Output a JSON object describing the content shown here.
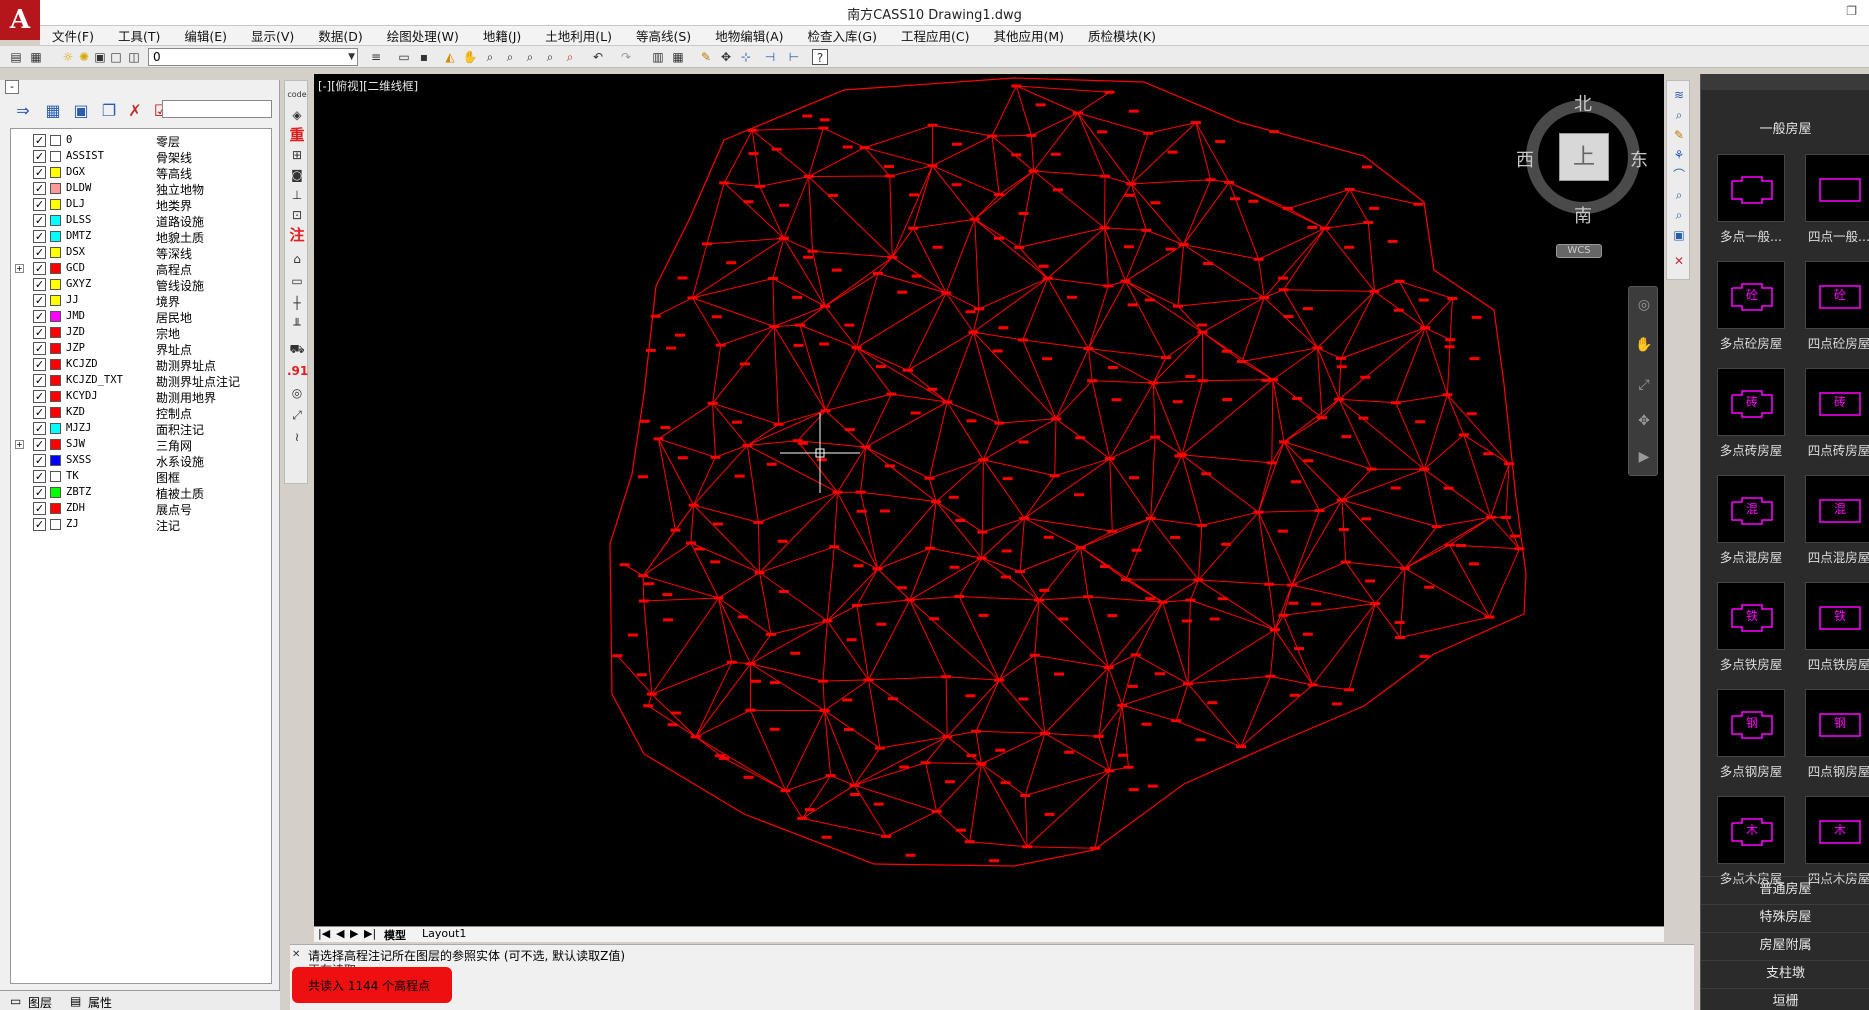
{
  "window": {
    "title": "南方CASS10    Drawing1.dwg",
    "logo": "A"
  },
  "menu": [
    "文件(F)",
    "工具(T)",
    "编辑(E)",
    "显示(V)",
    "数据(D)",
    "绘图处理(W)",
    "地籍(J)",
    "土地利用(L)",
    "等高线(S)",
    "地物编辑(A)",
    "检查入库(G)",
    "工程应用(C)",
    "其他应用(M)",
    "质检模块(K)"
  ],
  "toolbar": {
    "current_layer": "0"
  },
  "layer_panel": {
    "layers": [
      {
        "name": "0",
        "desc": "零层",
        "color": "#ffffff",
        "expander": ""
      },
      {
        "name": "ASSIST",
        "desc": "骨架线",
        "color": "#ffffff",
        "expander": ""
      },
      {
        "name": "DGX",
        "desc": "等高线",
        "color": "#ffff00",
        "expander": ""
      },
      {
        "name": "DLDW",
        "desc": "独立地物",
        "color": "#ff9999",
        "expander": ""
      },
      {
        "name": "DLJ",
        "desc": "地类界",
        "color": "#ffff00",
        "expander": ""
      },
      {
        "name": "DLSS",
        "desc": "道路设施",
        "color": "#00ffff",
        "expander": ""
      },
      {
        "name": "DMTZ",
        "desc": "地貌土质",
        "color": "#00ffff",
        "expander": ""
      },
      {
        "name": "DSX",
        "desc": "等深线",
        "color": "#ffff00",
        "expander": ""
      },
      {
        "name": "GCD",
        "desc": "高程点",
        "color": "#ff0000",
        "expander": "+"
      },
      {
        "name": "GXYZ",
        "desc": "管线设施",
        "color": "#ffff00",
        "expander": ""
      },
      {
        "name": "JJ",
        "desc": "境界",
        "color": "#ffff00",
        "expander": ""
      },
      {
        "name": "JMD",
        "desc": "居民地",
        "color": "#ff00ff",
        "expander": ""
      },
      {
        "name": "JZD",
        "desc": "宗地",
        "color": "#ff0000",
        "expander": ""
      },
      {
        "name": "JZP",
        "desc": "界址点",
        "color": "#ff0000",
        "expander": ""
      },
      {
        "name": "KCJZD",
        "desc": "勘测界址点",
        "color": "#ff0000",
        "expander": ""
      },
      {
        "name": "KCJZD_TXT",
        "desc": "勘测界址点注记",
        "color": "#ff0000",
        "expander": ""
      },
      {
        "name": "KCYDJ",
        "desc": "勘测用地界",
        "color": "#ff0000",
        "expander": ""
      },
      {
        "name": "KZD",
        "desc": "控制点",
        "color": "#ff0000",
        "expander": ""
      },
      {
        "name": "MJZJ",
        "desc": "面积注记",
        "color": "#00ffff",
        "expander": ""
      },
      {
        "name": "SJW",
        "desc": "三角网",
        "color": "#ff0000",
        "expander": "+"
      },
      {
        "name": "SXSS",
        "desc": "水系设施",
        "color": "#0000ff",
        "expander": ""
      },
      {
        "name": "TK",
        "desc": "图框",
        "color": "#ffffff",
        "expander": ""
      },
      {
        "name": "ZBTZ",
        "desc": "植被土质",
        "color": "#00ff00",
        "expander": ""
      },
      {
        "name": "ZDH",
        "desc": "展点号",
        "color": "#ff0000",
        "expander": ""
      },
      {
        "name": "ZJ",
        "desc": "注记",
        "color": "#ffffff",
        "expander": ""
      }
    ],
    "tabs": [
      "图层",
      "属性"
    ]
  },
  "viewport": {
    "label": "[-][俯视][二维线框]"
  },
  "viewcube": {
    "north": "北",
    "south": "南",
    "east": "东",
    "west": "西",
    "top": "上",
    "wcs": "WCS"
  },
  "layout_tabs": [
    "模型",
    "Layout1"
  ],
  "command": {
    "line1": "请选择高程注记所在图层的参照实体 (可不选, 默认读取Z值)",
    "line2": "正在读取...",
    "result": "共读入 1144 个高程点"
  },
  "palette": {
    "title": "一般房屋",
    "tiles": [
      {
        "label": "多点一般...",
        "glyph": ""
      },
      {
        "label": "四点一般...",
        "glyph": ""
      },
      {
        "label": "多点砼房屋",
        "glyph": "砼"
      },
      {
        "label": "四点砼房屋",
        "glyph": "砼"
      },
      {
        "label": "多点砖房屋",
        "glyph": "砖"
      },
      {
        "label": "四点砖房屋",
        "glyph": "砖"
      },
      {
        "label": "多点混房屋",
        "glyph": "混"
      },
      {
        "label": "四点混房屋",
        "glyph": "混"
      },
      {
        "label": "多点铁房屋",
        "glyph": "铁"
      },
      {
        "label": "四点铁房屋",
        "glyph": "铁"
      },
      {
        "label": "多点钢房屋",
        "glyph": "钢"
      },
      {
        "label": "四点钢房屋",
        "glyph": "钢"
      },
      {
        "label": "多点木房屋",
        "glyph": "木"
      },
      {
        "label": "四点木房屋",
        "glyph": "木"
      }
    ],
    "sections": [
      "普通房屋",
      "特殊房屋",
      "房屋附属",
      "支柱墩",
      "垣栅"
    ]
  },
  "colors": {
    "tin": "#ff0000",
    "tile_outline": "#ff00ff",
    "canvas": "#000000"
  }
}
